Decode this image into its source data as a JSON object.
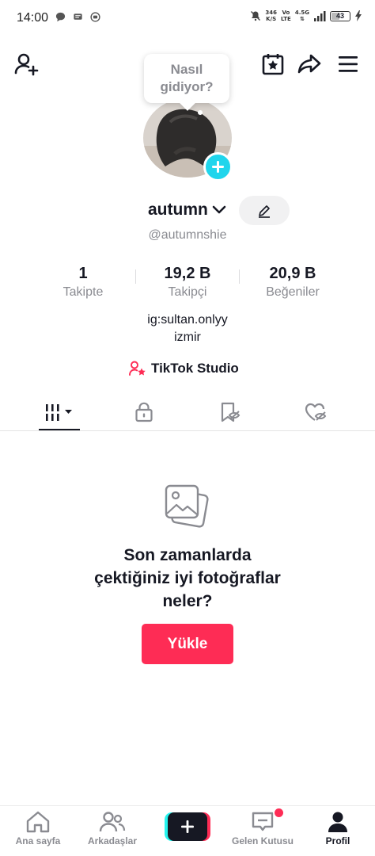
{
  "status_bar": {
    "time": "14:00",
    "net_speed": "346",
    "net_unit": "K/S",
    "vo": "Vo",
    "lte": "LTE",
    "network": "4.5G",
    "battery": "43"
  },
  "profile": {
    "note_bubble": "Nasıl gidiyor?",
    "username": "autumn",
    "handle": "@autumnshie",
    "stats": [
      {
        "value": "1",
        "label": "Takipte"
      },
      {
        "value": "19,2 B",
        "label": "Takipçi"
      },
      {
        "value": "20,9 B",
        "label": "Beğeniler"
      }
    ],
    "bio_line1": "ig:sultan.onlyy",
    "bio_line2": "izmir",
    "studio_label": "TikTok Studio"
  },
  "empty_state": {
    "title_line1": "Son zamanlarda",
    "title_line2": "çektiğiniz iyi fotoğraflar",
    "title_line3": "neler?",
    "upload_label": "Yükle"
  },
  "bottom_nav": {
    "home": "Ana sayfa",
    "friends": "Arkadaşlar",
    "inbox": "Gelen Kutusu",
    "profile": "Profil"
  },
  "colors": {
    "accent": "#fe2c55",
    "cyan": "#20d5ec",
    "text": "#161823",
    "muted": "#8a8b91"
  }
}
